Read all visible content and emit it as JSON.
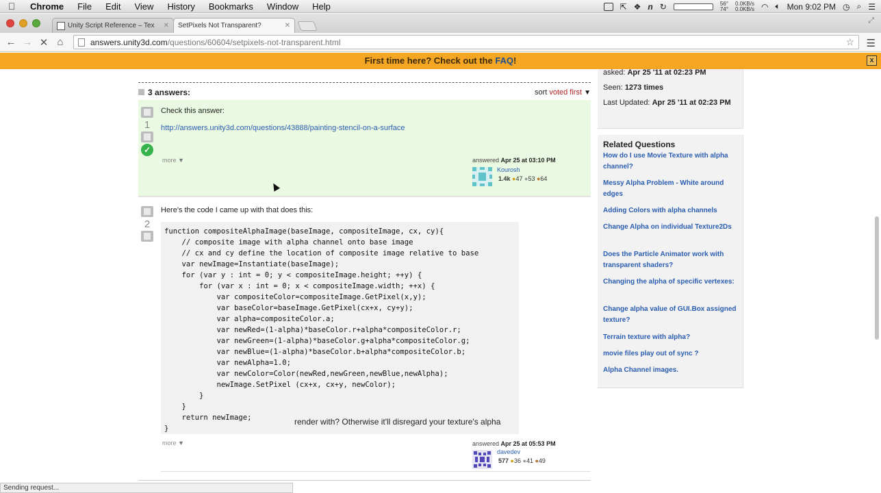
{
  "menubar": {
    "items": [
      "Chrome",
      "File",
      "Edit",
      "View",
      "History",
      "Bookmarks",
      "Window",
      "Help"
    ],
    "clock": "Mon 9:02 PM",
    "net_up": "0.0KB/s",
    "net_down": "0.0KB/s",
    "temp1": "56°",
    "temp2": "74°"
  },
  "tabs": [
    {
      "title": "Unity Script Reference – Tex",
      "active": false
    },
    {
      "title": "SetPixels Not Transparent?",
      "active": true
    }
  ],
  "toolbar": {
    "url_host": "answers.unity3d.com",
    "url_path": "/questions/60604/setpixels-not-transparent.html"
  },
  "banner": {
    "text": "First time here? Check out the ",
    "link": "FAQ",
    "suffix": "!",
    "close": "x"
  },
  "answers_header": {
    "count": "3 answers:",
    "sort_label": "sort ",
    "sort_value": "voted first"
  },
  "answer1": {
    "votes": "1",
    "text": "Check this answer:",
    "link": "http://answers.unity3d.com/questions/43888/painting-stencil-on-a-surface",
    "more": "more",
    "answered_prefix": "answered ",
    "answered_date": "Apr 25 at 03:10 PM",
    "user": "Kourosh",
    "rep": "1.4k",
    "gold": "47",
    "silver": "53",
    "bronze": "64"
  },
  "answer2": {
    "votes": "2",
    "text": "Here's the code I came up with that does this:",
    "code": "function compositeAlphaImage(baseImage, compositeImage, cx, cy){\n    // composite image with alpha channel onto base image\n    // cx and cy define the location of composite image relative to base\n    var newImage=Instantiate(baseImage);\n    for (var y : int = 0; y < compositeImage.height; ++y) {\n        for (var x : int = 0; x < compositeImage.width; ++x) {\n            var compositeColor=compositeImage.GetPixel(x,y);\n            var baseColor=baseImage.GetPixel(cx+x, cy+y);\n            var alpha=compositeColor.a;\n            var newRed=(1-alpha)*baseColor.r+alpha*compositeColor.r;\n            var newGreen=(1-alpha)*baseColor.g+alpha*compositeColor.g;\n            var newBlue=(1-alpha)*baseColor.b+alpha*compositeColor.b;\n            var newAlpha=1.0;\n            var newColor=Color(newRed,newGreen,newBlue,newAlpha);\n            newImage.SetPixel (cx+x, cx+y, newColor);\n        }\n    }\n    return newImage;\n}",
    "more": "more",
    "answered_prefix": "answered ",
    "answered_date": "Apr 25 at 05:53 PM",
    "user": "davedev",
    "rep": "577",
    "gold": "36",
    "silver": "41",
    "bronze": "49"
  },
  "answer3_fragment": "render with? Otherwise it'll disregard your texture's alpha",
  "status_bar": "Sending request...",
  "sidebar": {
    "asked_label": "asked: ",
    "asked_value": "Apr 25 '11 at 02:23 PM",
    "seen_label": "Seen: ",
    "seen_value": "1273 times",
    "updated_label": "Last Updated: ",
    "updated_value": "Apr 25 '11 at 02:23 PM",
    "related_title": "Related Questions",
    "related": [
      "How do I use Movie Texture with alpha channel?",
      "Messy Alpha Problem - White around edges",
      "Adding Colors with alpha channels",
      "Change Alpha on individual Texture2Ds",
      "Does the Particle Animator work with transparent shaders?",
      "Changing the alpha of specific vertexes:",
      "Change alpha value of GUI.Box assigned texture?",
      "Terrain texture with alpha?",
      "movie files play out of sync ?",
      "Alpha Channel images."
    ]
  },
  "colors": {
    "banner": "#f5a623",
    "accepted_bg": "#eaf9e2",
    "link": "#2a5db0",
    "accept_check": "#35b24a"
  }
}
